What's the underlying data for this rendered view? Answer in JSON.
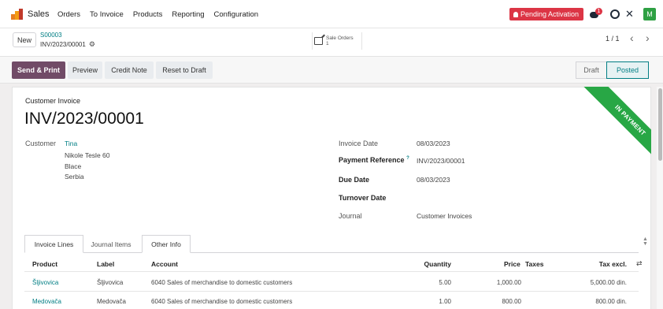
{
  "navbar": {
    "app_name": "Sales",
    "menu": [
      "Orders",
      "To Invoice",
      "Products",
      "Reporting",
      "Configuration"
    ],
    "pending_label": "Pending Activation",
    "chat_badge": "1",
    "avatar_letter": "M"
  },
  "control": {
    "new_label": "New",
    "breadcrumb_parent": "S00003",
    "breadcrumb_current": "INV/2023/00001",
    "smart_button_title": "Sale Orders",
    "smart_button_count": "1",
    "pager": "1 / 1"
  },
  "actions": {
    "send_print": "Send & Print",
    "preview": "Preview",
    "credit_note": "Credit Note",
    "reset_draft": "Reset to Draft"
  },
  "status": {
    "draft": "Draft",
    "posted": "Posted"
  },
  "ribbon": "IN PAYMENT",
  "invoice": {
    "kind": "Customer Invoice",
    "number": "INV/2023/00001",
    "customer_label": "Customer",
    "customer_name": "Tina",
    "address": [
      "Nikole Tesle 60",
      "Blace",
      "Serbia"
    ],
    "invoice_date_label": "Invoice Date",
    "invoice_date": "08/03/2023",
    "payment_ref_label": "Payment Reference",
    "payment_ref_help": "?",
    "payment_ref": "INV/2023/00001",
    "due_date_label": "Due Date",
    "due_date": "08/03/2023",
    "turnover_label": "Turnover Date",
    "journal_label": "Journal",
    "journal": "Customer Invoices"
  },
  "tabs": [
    "Invoice Lines",
    "Journal Items",
    "Other Info"
  ],
  "table": {
    "headers": {
      "product": "Product",
      "label": "Label",
      "account": "Account",
      "quantity": "Quantity",
      "price": "Price",
      "taxes": "Taxes",
      "tax_excl": "Tax excl."
    },
    "rows": [
      {
        "product": "Šljivovica",
        "label": "Šljivovica",
        "account": "6040 Sales of merchandise to domestic customers",
        "quantity": "5.00",
        "price": "1,000.00",
        "tax_excl": "5,000.00 din."
      },
      {
        "product": "Medovača",
        "label": "Medovača",
        "account": "6040 Sales of merchandise to domestic customers",
        "quantity": "1.00",
        "price": "800.00",
        "tax_excl": "800.00 din."
      }
    ]
  },
  "colors": {
    "brand": "#714b67",
    "teal": "#017e84",
    "ribbon": "#28a745",
    "danger": "#dc3545"
  }
}
